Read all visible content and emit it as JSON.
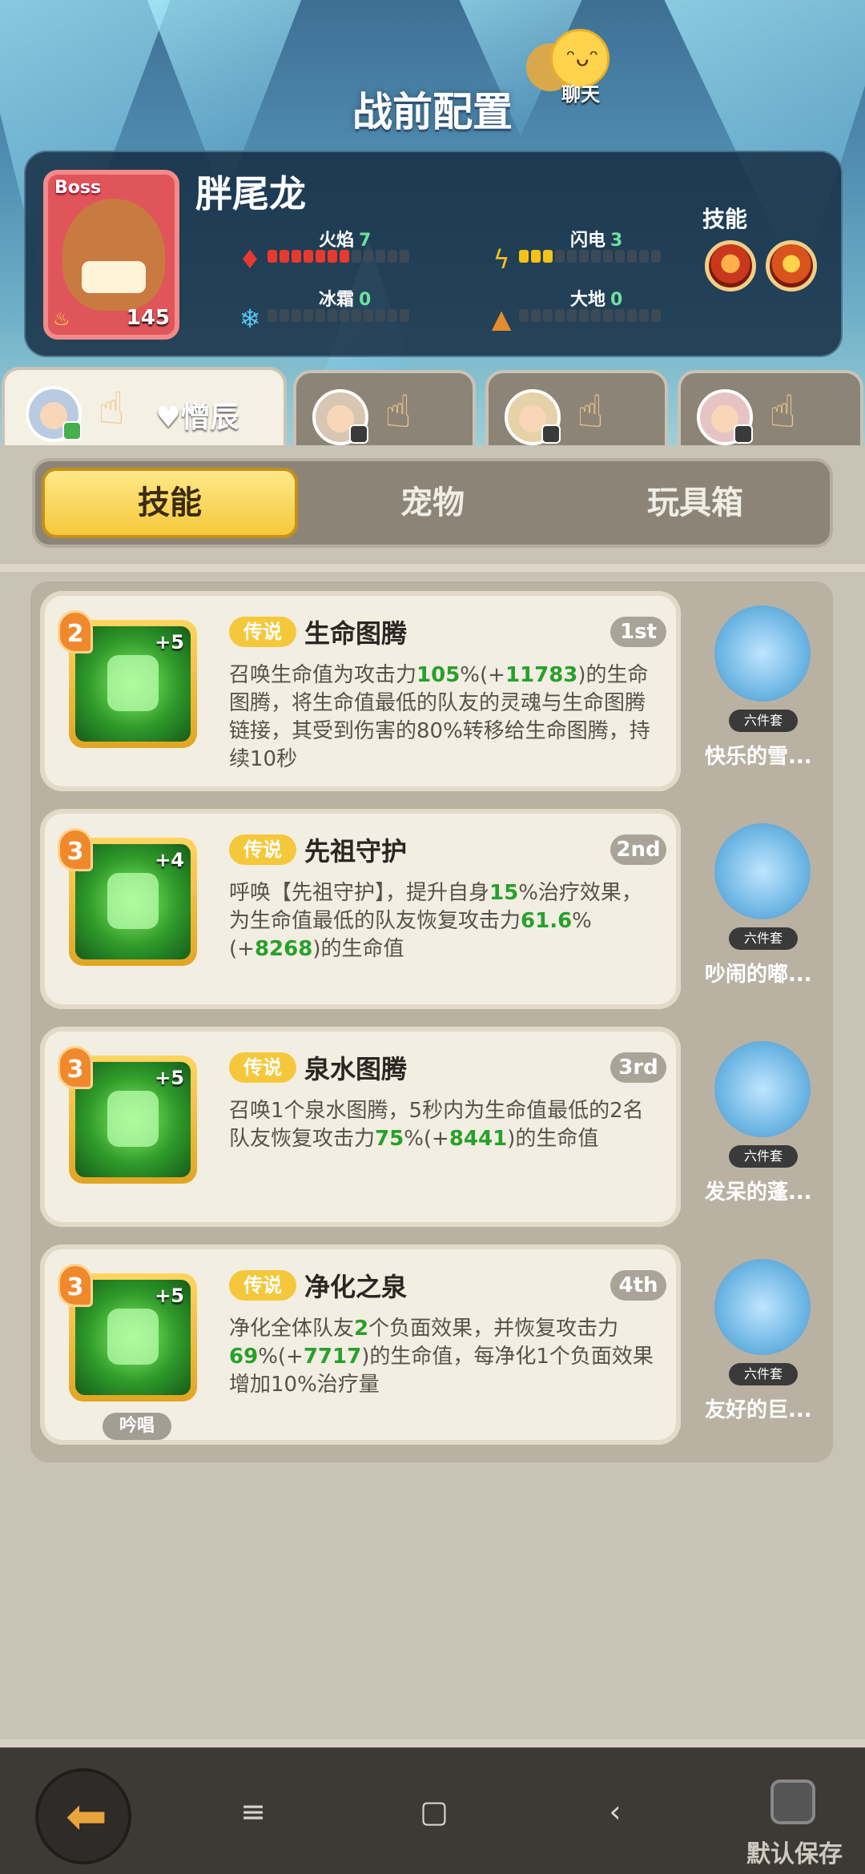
{
  "header": {
    "title": "战前配置",
    "chat_label": "聊天"
  },
  "boss": {
    "tag": "Boss",
    "name": "胖尾龙",
    "level": "145",
    "stats": [
      {
        "label": "火焰",
        "value": "7",
        "icon": "fire-icon",
        "filled": 7,
        "color": "#e8392f"
      },
      {
        "label": "闪电",
        "value": "3",
        "icon": "lightning-icon",
        "filled": 3,
        "color": "#f5c218"
      },
      {
        "label": "冰霜",
        "value": "0",
        "icon": "frost-icon",
        "filled": 0,
        "color": "#58c7f2"
      },
      {
        "label": "大地",
        "value": "0",
        "icon": "earth-icon",
        "filled": 0,
        "color": "#e58c2e"
      }
    ],
    "skills_label": "技能"
  },
  "hero_tabs": [
    {
      "name": "♥憎辰",
      "active": true
    },
    {
      "name": "",
      "active": false
    },
    {
      "name": "",
      "active": false
    },
    {
      "name": "",
      "active": false
    }
  ],
  "segments": [
    "技能",
    "宠物",
    "玩具箱"
  ],
  "skills": [
    {
      "level": "2",
      "plus": "+5",
      "rarity": "传说",
      "name": "生命图腾",
      "order": "1st",
      "desc_parts": [
        [
          "召唤生命值为攻击力",
          ""
        ],
        [
          "105",
          "n"
        ],
        [
          "%(+",
          ""
        ],
        [
          "11783",
          "n"
        ],
        [
          ")的生命图腾，将生命值最低的队友的灵魂与生命图腾链接，其受到伤害的80%转移给生命图腾，持续10秒",
          ""
        ]
      ]
    },
    {
      "level": "3",
      "plus": "+4",
      "rarity": "传说",
      "name": "先祖守护",
      "order": "2nd",
      "desc_parts": [
        [
          "呼唤【先祖守护】，提升自身",
          ""
        ],
        [
          "15",
          "n"
        ],
        [
          "%治疗效果，为生命值最低的队友恢复攻击力",
          ""
        ],
        [
          "61.6",
          "n"
        ],
        [
          "%(+",
          ""
        ],
        [
          "8268",
          "n"
        ],
        [
          ")的生命值",
          ""
        ]
      ]
    },
    {
      "level": "3",
      "plus": "+5",
      "rarity": "传说",
      "name": "泉水图腾",
      "order": "3rd",
      "desc_parts": [
        [
          "召唤1个泉水图腾，5秒内为生命值最低的2名队友恢复攻击力",
          ""
        ],
        [
          "75",
          "n"
        ],
        [
          "%(+",
          ""
        ],
        [
          "8441",
          "n"
        ],
        [
          ")的生命值",
          ""
        ]
      ]
    },
    {
      "level": "3",
      "plus": "+5",
      "rarity": "传说",
      "name": "净化之泉",
      "order": "4th",
      "chant": "吟唱",
      "desc_parts": [
        [
          "净化全体队友",
          ""
        ],
        [
          "2",
          "n"
        ],
        [
          "个负面效果，并恢复攻击力",
          ""
        ],
        [
          "69",
          "n"
        ],
        [
          "%(+",
          ""
        ],
        [
          "7717",
          "n"
        ],
        [
          ")的生命值，每净化1个负面效果增加10%治疗量",
          ""
        ]
      ]
    }
  ],
  "pets": [
    {
      "set": "六件套",
      "name": "快乐的雪..."
    },
    {
      "set": "六件套",
      "name": "吵闹的嘟..."
    },
    {
      "set": "六件套",
      "name": "发呆的蓬..."
    },
    {
      "set": "六件套",
      "name": "友好的巨..."
    }
  ],
  "bottom": {
    "save_label": "默认保存"
  },
  "colors": {
    "accent": "#f4c83a",
    "number_green": "#28a02c",
    "panel_dark": "#12283e"
  }
}
